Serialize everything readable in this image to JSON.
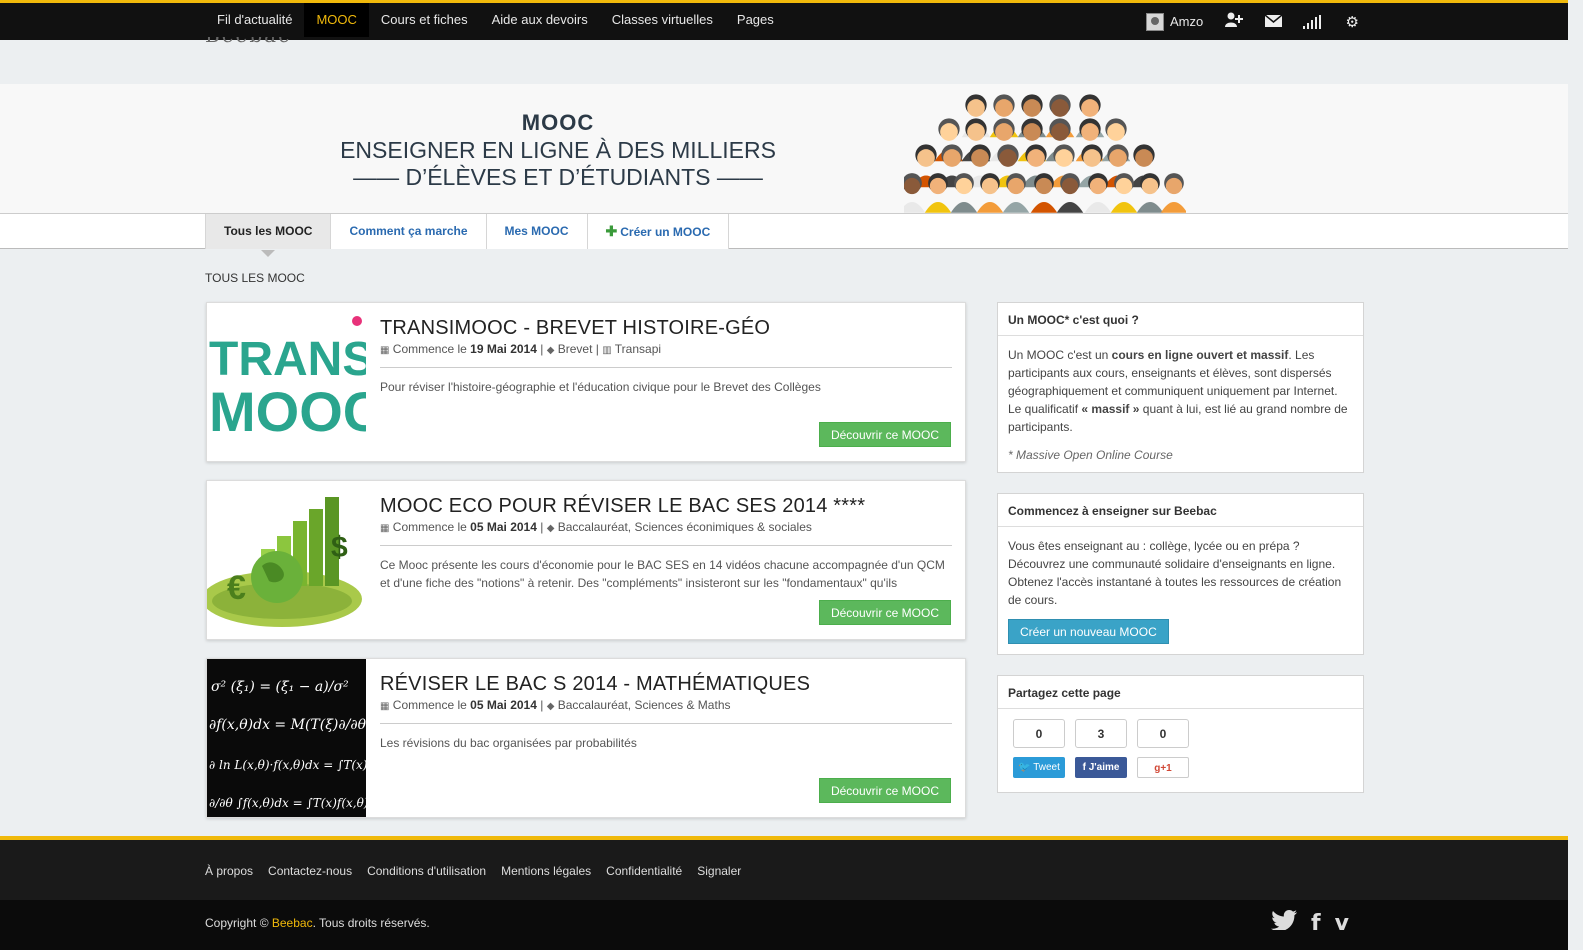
{
  "nav": {
    "items": [
      {
        "label": "Fil d'actualité",
        "active": false
      },
      {
        "label": "MOOC",
        "active": true
      },
      {
        "label": "Cours et fiches",
        "active": false
      },
      {
        "label": "Aide aux devoirs",
        "active": false
      },
      {
        "label": "Classes virtuelles",
        "active": false
      },
      {
        "label": "Pages",
        "active": false
      }
    ],
    "user": "Amzo",
    "icons": [
      "add-user-icon",
      "mail-icon",
      "signal-icon",
      "gear-icon"
    ]
  },
  "banner": {
    "title": "MOOC",
    "line1": "ENSEIGNER EN LIGNE À DES MILLIERS",
    "line2": "—— D’ÉLÈVES ET D’ÉTUDIANTS ——"
  },
  "tabs": [
    {
      "label": "Tous les MOOC",
      "active": true
    },
    {
      "label": "Comment ça marche",
      "active": false
    },
    {
      "label": "Mes MOOC",
      "active": false
    },
    {
      "label": "Créer un MOOC",
      "active": false,
      "icon": "plus-icon"
    }
  ],
  "section_label": "Tous les MOOC",
  "moocs": [
    {
      "title": "TRANSIMOOC - BREVET HISTOIRE-GÉO",
      "starts_prefix": "Commence le",
      "date": "19 Mai 2014",
      "tags": "Brevet",
      "author": "Transapi",
      "description": "Pour réviser l'histoire-géographie et l'éducation civique pour le Brevet des Collèges",
      "button": "Découvrir ce MOOC",
      "thumb": {
        "line1": "TRANSi",
        "line2": "MOOC"
      }
    },
    {
      "title": "MOOC ECO POUR RÉVISER LE BAC SES 2014 ****",
      "starts_prefix": "Commence le",
      "date": "05 Mai 2014",
      "tags": "Baccalauréat, Sciences éconimiques & sociales",
      "description": "Ce Mooc présente les cours d'économie pour le BAC SES en 14 vidéos chacune accompagnée d'un QCM et d'une fiche des \"notions\" à retenir. Des \"compléments\" insisteront sur les \"fondamentaux\" qu'ils",
      "button": "Découvrir ce MOOC"
    },
    {
      "title": "RÉVISER LE BAC S 2014 - MATHÉMATIQUES",
      "starts_prefix": "Commence le",
      "date": "05 Mai 2014",
      "tags": "Baccalauréat, Sciences & Maths",
      "description": "Les révisions du bac organisées par probabilités",
      "button": "Découvrir ce MOOC",
      "thumb": {
        "f1": "σ² (ξ₁) = (ξ₁ − a)/σ²",
        "f2": "∂f(x,θ)dx = M(T(ξ)∂/∂θ",
        "f3": "∂ ln L(x,θ)·f(x,θ)dx = ∫T(x)",
        "f4": "∂/∂θ ∫f(x,θ)dx = ∫T(x)f(x,θ)dx"
      }
    }
  ],
  "sidebar": {
    "what": {
      "title": "Un MOOC* c'est quoi ?",
      "p1_a": "Un MOOC c'est un ",
      "p1_b": "cours en ligne ouvert et massif",
      "p1_c": ". Les participants aux cours, enseignants et élèves, sont dispersés géographiquement et communiquent uniquement par Internet. Le qualificatif ",
      "p1_d": "« massif »",
      "p1_e": " quant à lui, est lié au grand nombre de participants.",
      "note": "* Massive Open Online Course"
    },
    "teach": {
      "title": "Commencez à enseigner sur Beebac",
      "text": "Vous êtes enseignant au : collège, lycée ou en prépa ? Découvrez une communauté solidaire d'enseignants en ligne. Obtenez l'accès instantané à toutes les ressources de création de cours.",
      "button": "Créer un nouveau MOOC"
    },
    "share": {
      "title": "Partagez cette page",
      "items": [
        {
          "count": "0",
          "label": "Tweet"
        },
        {
          "count": "3",
          "label": "J'aime"
        },
        {
          "count": "0",
          "label": "+1"
        }
      ]
    }
  },
  "footer": {
    "links": [
      "À propos",
      "Contactez-nous",
      "Conditions d'utilisation",
      "Mentions légales",
      "Confidentialité",
      "Signaler"
    ],
    "copy_prefix": "Copyright © ",
    "brand": "Beebac",
    "copy_suffix": ". Tous droits réservés.",
    "social": [
      "twitter-icon",
      "facebook-icon",
      "vimeo-icon"
    ]
  },
  "colors": {
    "accent": "#f0b90b",
    "nav_bg": "#111111",
    "button_green": "#5cb85c",
    "button_blue": "#3aa3c7",
    "link_blue": "#2a6ab0"
  }
}
